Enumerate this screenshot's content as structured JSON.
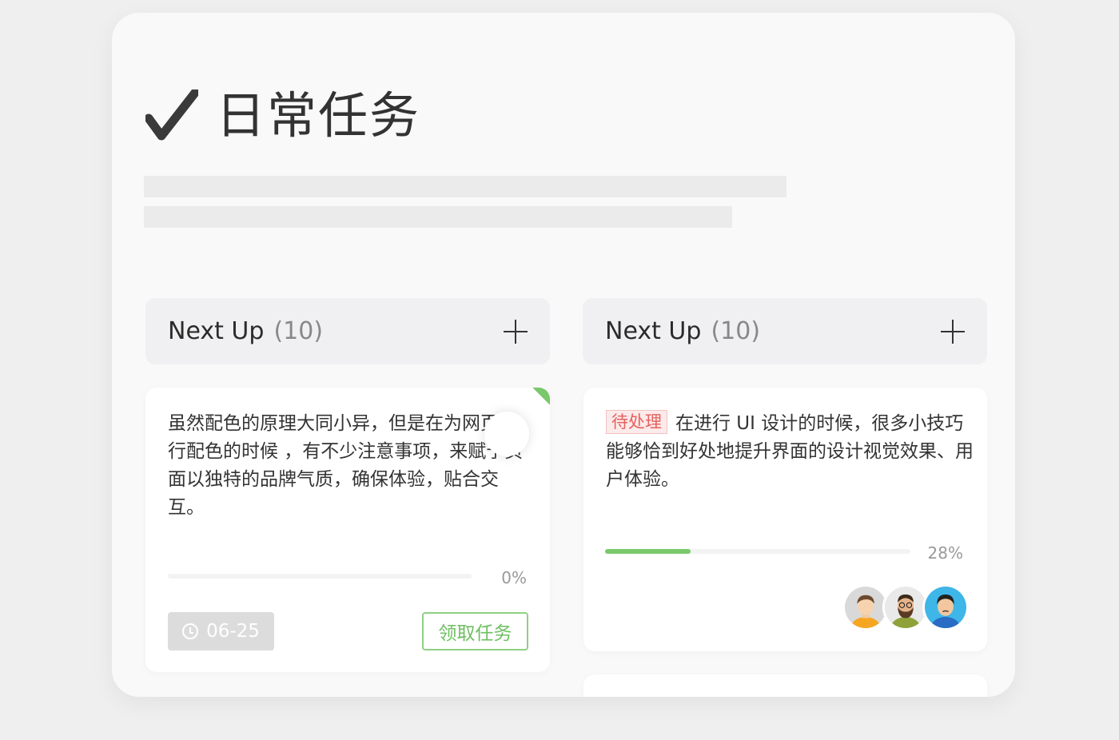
{
  "header": {
    "title": "日常任务",
    "icon": "check-icon"
  },
  "columns": [
    {
      "title": "Next Up",
      "count": "(10)",
      "add_icon": "plus-icon"
    },
    {
      "title": "Next Up",
      "count": "(10)",
      "add_icon": "plus-icon"
    }
  ],
  "cards": [
    {
      "text": "虽然配色的原理大同小异，但是在为网页进行配色的时候 ，有不少注意事项，来赋予页面以独特的品牌气质，确保体验，贴合交互。",
      "progress": 0,
      "progress_label": "0%",
      "date": "06-25",
      "claim_label": "领取任务",
      "accent_color": "#7bc86c"
    },
    {
      "tag": "待处理",
      "text": "在进行 UI 设计的时候，很多小技巧能够恰到好处地提升界面的设计视觉效果、用户体验。",
      "progress": 0.28,
      "progress_label": "28%",
      "accent_color": "#7bc86c"
    }
  ],
  "colors": {
    "accent": "#7bc86c",
    "tag_red": "#e4625f",
    "background": "#efefef",
    "panel": "#f9f9f9"
  }
}
